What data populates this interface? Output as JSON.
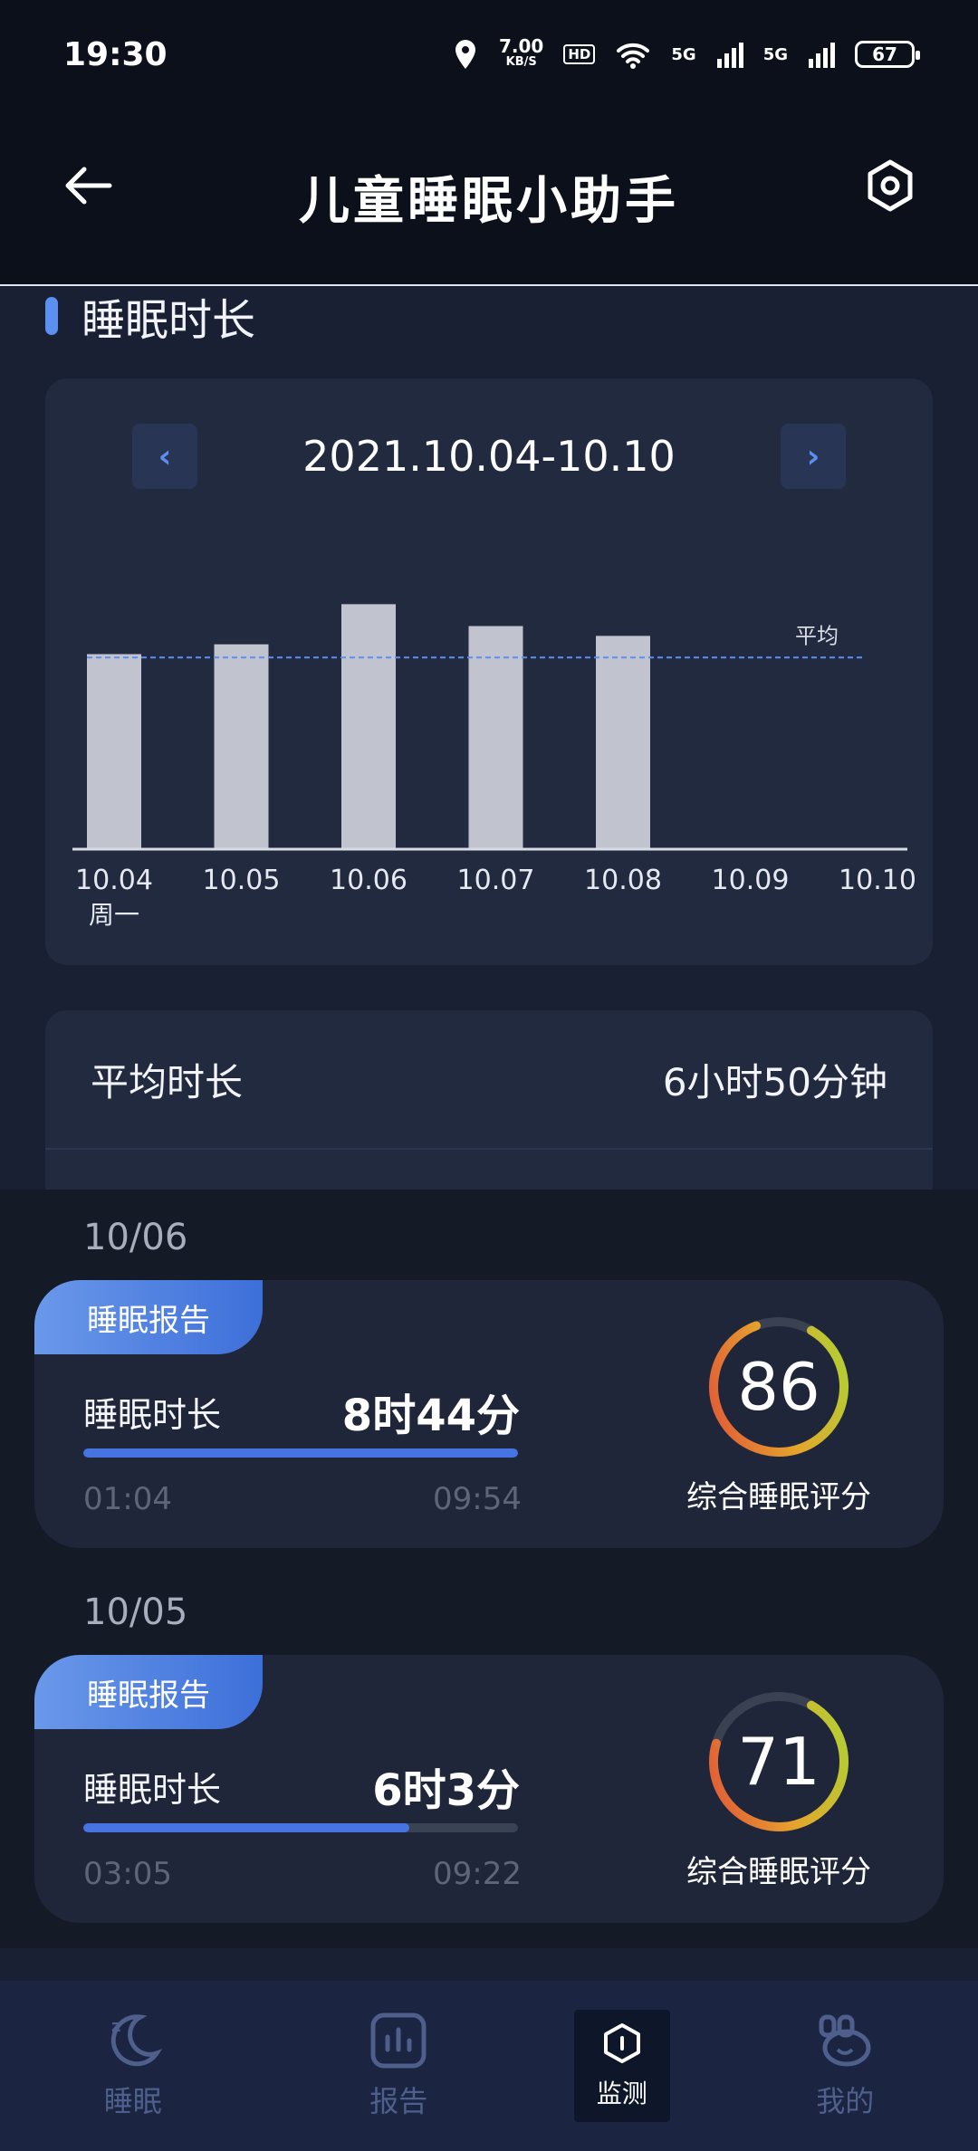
{
  "status_bar": {
    "time": "19:30",
    "net_speed": "7.00",
    "net_unit": "KB/S",
    "hd": "HD",
    "sig1": "5G",
    "sig2": "5G",
    "battery": "67"
  },
  "header": {
    "title": "儿童睡眠小助手"
  },
  "section": {
    "title": "睡眠时长"
  },
  "chart_data": {
    "type": "bar",
    "date_range": "2021.10.04-10.10",
    "categories": [
      "10.04",
      "10.05",
      "10.06",
      "10.07",
      "10.08",
      "10.09",
      "10.10"
    ],
    "sub_label": "周一",
    "values": [
      6.95,
      7.3,
      8.73,
      7.95,
      7.6,
      0,
      0
    ],
    "average": 6.83,
    "average_label": "平均",
    "ylim": [
      0,
      10
    ]
  },
  "summary": {
    "avg_label": "平均时长",
    "avg_value": "6小时50分钟"
  },
  "reports": [
    {
      "date": "10/06",
      "tag": "睡眠报告",
      "duration_label": "睡眠时长",
      "duration": "8时44分",
      "progress": 1.0,
      "start": "01:04",
      "end": "09:54",
      "score": "86",
      "score_label": "综合睡眠评分"
    },
    {
      "date": "10/05",
      "tag": "睡眠报告",
      "duration_label": "睡眠时长",
      "duration": "6时3分",
      "progress": 0.75,
      "start": "03:05",
      "end": "09:22",
      "score": "71",
      "score_label": "综合睡眠评分"
    }
  ],
  "bottom_nav": [
    {
      "label": "睡眠",
      "icon": "moon-icon"
    },
    {
      "label": "报告",
      "icon": "bar-chart-icon"
    },
    {
      "label": "监测",
      "icon": "monitor-icon",
      "active": true
    },
    {
      "label": "我的",
      "icon": "bear-icon"
    }
  ]
}
